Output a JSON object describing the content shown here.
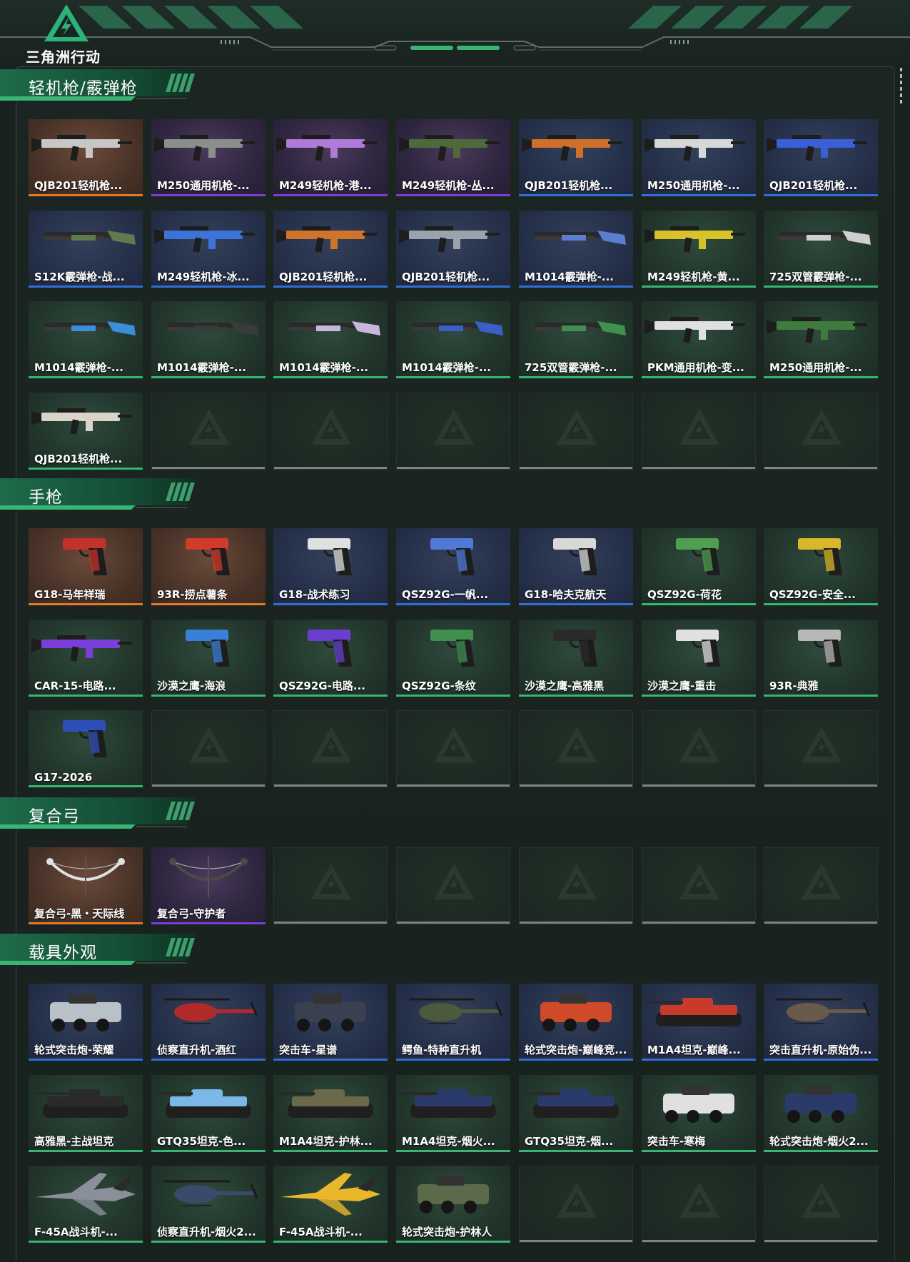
{
  "header": {
    "logo_text": "三角洲行动"
  },
  "colors": {
    "background": "#19221f",
    "accent_green": "#2fb27a",
    "rarity": {
      "orange": "#e07a2a",
      "purple": "#7b3fd0",
      "blue": "#2f6fd6",
      "green": "#36b574",
      "gray": "#7c8581"
    }
  },
  "sections": [
    {
      "title": "轻机枪/霰弹枪",
      "icon": "gun-icon",
      "items": [
        {
          "label": "QJB201轻机枪...",
          "rarity": "orange",
          "icon": "rifle-icon",
          "tone": "#c7c7c7"
        },
        {
          "label": "M250通用机枪-...",
          "rarity": "purple",
          "icon": "rifle-icon",
          "tone": "#8a8f8c"
        },
        {
          "label": "M249轻机枪-港...",
          "rarity": "purple",
          "icon": "rifle-icon",
          "tone": "#b07ad8"
        },
        {
          "label": "M249轻机枪-丛...",
          "rarity": "purple",
          "icon": "rifle-icon",
          "tone": "#4f6a3a"
        },
        {
          "label": "QJB201轻机枪...",
          "rarity": "blue",
          "icon": "rifle-icon",
          "tone": "#d06f2a"
        },
        {
          "label": "M250通用机枪-...",
          "rarity": "blue",
          "icon": "rifle-icon",
          "tone": "#d7d7d7"
        },
        {
          "label": "QJB201轻机枪...",
          "rarity": "blue",
          "icon": "rifle-icon",
          "tone": "#3b5fd6"
        },
        {
          "label": "S12K霰弹枪-战...",
          "rarity": "blue",
          "icon": "shotgun-icon",
          "tone": "#5f7a4e"
        },
        {
          "label": "M249轻机枪-冰...",
          "rarity": "blue",
          "icon": "rifle-icon",
          "tone": "#3b73d8"
        },
        {
          "label": "QJB201轻机枪...",
          "rarity": "blue",
          "icon": "rifle-icon",
          "tone": "#d0742a"
        },
        {
          "label": "QJB201轻机枪...",
          "rarity": "blue",
          "icon": "rifle-icon",
          "tone": "#9aa3ad"
        },
        {
          "label": "M1014霰弹枪-...",
          "rarity": "blue",
          "icon": "shotgun-icon",
          "tone": "#5a7fd0"
        },
        {
          "label": "M249轻机枪-黄...",
          "rarity": "green",
          "icon": "rifle-icon",
          "tone": "#d8c22a"
        },
        {
          "label": "725双管霰弹枪-...",
          "rarity": "green",
          "icon": "shotgun-icon",
          "tone": "#cfcfcf"
        },
        {
          "label": "M1014霰弹枪-...",
          "rarity": "green",
          "icon": "shotgun-icon",
          "tone": "#3a8fd8"
        },
        {
          "label": "M1014霰弹枪-...",
          "rarity": "green",
          "icon": "shotgun-icon",
          "tone": "#3a3a3a"
        },
        {
          "label": "M1014霰弹枪-...",
          "rarity": "green",
          "icon": "shotgun-icon",
          "tone": "#c9b6dd"
        },
        {
          "label": "M1014霰弹枪-...",
          "rarity": "green",
          "icon": "shotgun-icon",
          "tone": "#3a5fc8"
        },
        {
          "label": "725双管霰弹枪-...",
          "rarity": "green",
          "icon": "shotgun-icon",
          "tone": "#3f8f4f"
        },
        {
          "label": "PKM通用机枪-变...",
          "rarity": "green",
          "icon": "rifle-icon",
          "tone": "#e0e0e0"
        },
        {
          "label": "M250通用机枪-...",
          "rarity": "green",
          "icon": "rifle-icon",
          "tone": "#3f7a3f"
        },
        {
          "label": "QJB201轻机枪...",
          "rarity": "green",
          "icon": "rifle-icon",
          "tone": "#d8d4c8"
        }
      ],
      "empty_slots": 6
    },
    {
      "title": "手枪",
      "icon": "pistol-icon",
      "items": [
        {
          "label": "G18-马年祥瑞",
          "rarity": "orange",
          "icon": "pistol-icon",
          "tone": "#c0322a"
        },
        {
          "label": "93R-捞点薯条",
          "rarity": "orange",
          "icon": "pistol-icon",
          "tone": "#d23a2a"
        },
        {
          "label": "G18-战术练习",
          "rarity": "blue",
          "icon": "pistol-icon",
          "tone": "#e0e0e0"
        },
        {
          "label": "QSZ92G-一帆...",
          "rarity": "blue",
          "icon": "pistol-icon",
          "tone": "#4f7ad8"
        },
        {
          "label": "G18-哈夫克航天",
          "rarity": "blue",
          "icon": "pistol-icon",
          "tone": "#d8d8d8"
        },
        {
          "label": "QSZ92G-荷花",
          "rarity": "green",
          "icon": "pistol-icon",
          "tone": "#4f9f4f"
        },
        {
          "label": "QSZ92G-安全...",
          "rarity": "green",
          "icon": "pistol-icon",
          "tone": "#d8b82a"
        },
        {
          "label": "CAR-15-电路...",
          "rarity": "green",
          "icon": "rifle-icon",
          "tone": "#7a3fd8"
        },
        {
          "label": "沙漠之鹰-海浪",
          "rarity": "green",
          "icon": "pistol-icon",
          "tone": "#3a7fd8"
        },
        {
          "label": "QSZ92G-电路...",
          "rarity": "green",
          "icon": "pistol-icon",
          "tone": "#6a3fd0"
        },
        {
          "label": "QSZ92G-条纹",
          "rarity": "green",
          "icon": "pistol-icon",
          "tone": "#3f8f4f"
        },
        {
          "label": "沙漠之鹰-高雅黑",
          "rarity": "green",
          "icon": "pistol-icon",
          "tone": "#2a2a2a"
        },
        {
          "label": "沙漠之鹰-重击",
          "rarity": "green",
          "icon": "pistol-icon",
          "tone": "#e0e0e0"
        },
        {
          "label": "93R-典雅",
          "rarity": "green",
          "icon": "pistol-icon",
          "tone": "#b8b8b8"
        },
        {
          "label": "G17-2026",
          "rarity": "green",
          "icon": "pistol-icon",
          "tone": "#2f4fb8"
        }
      ],
      "empty_slots": 6
    },
    {
      "title": "复合弓",
      "icon": "bow-icon",
      "items": [
        {
          "label": "复合弓-黑・天际线",
          "rarity": "orange",
          "icon": "bow-icon",
          "tone": "#e0e0e0"
        },
        {
          "label": "复合弓-守护者",
          "rarity": "purple",
          "icon": "bow-icon",
          "tone": "#4a4a4a"
        }
      ],
      "empty_slots": 5
    },
    {
      "title": "载具外观",
      "icon": "vehicle-icon",
      "items": [
        {
          "label": "轮式突击炮-荣耀",
          "rarity": "blue",
          "icon": "armored-car-icon",
          "tone": "#b8c0c8"
        },
        {
          "label": "侦察直升机-酒红",
          "rarity": "blue",
          "icon": "helicopter-icon",
          "tone": "#b02a2a"
        },
        {
          "label": "突击车-星谱",
          "rarity": "blue",
          "icon": "armored-car-icon",
          "tone": "#3a4050"
        },
        {
          "label": "鳄鱼-特种直升机",
          "rarity": "blue",
          "icon": "helicopter-icon",
          "tone": "#4a5a3a"
        },
        {
          "label": "轮式突击炮-巅峰竞...",
          "rarity": "blue",
          "icon": "armored-car-icon",
          "tone": "#d04a2a"
        },
        {
          "label": "M1A4坦克-巅峰...",
          "rarity": "blue",
          "icon": "tank-icon",
          "tone": "#c83a2a"
        },
        {
          "label": "突击直升机-原始伪...",
          "rarity": "blue",
          "icon": "helicopter-icon",
          "tone": "#6a5a4a"
        },
        {
          "label": "高雅黑-主战坦克",
          "rarity": "green",
          "icon": "tank-icon",
          "tone": "#2a2a2a"
        },
        {
          "label": "GTQ35坦克-色...",
          "rarity": "green",
          "icon": "tank-icon",
          "tone": "#7ab8e8"
        },
        {
          "label": "M1A4坦克-护林...",
          "rarity": "green",
          "icon": "tank-icon",
          "tone": "#6a6a4a"
        },
        {
          "label": "M1A4坦克-烟火...",
          "rarity": "green",
          "icon": "tank-icon",
          "tone": "#2a3a6a"
        },
        {
          "label": "GTQ35坦克-烟...",
          "rarity": "green",
          "icon": "tank-icon",
          "tone": "#2a3a6a"
        },
        {
          "label": "突击车-寒梅",
          "rarity": "green",
          "icon": "armored-car-icon",
          "tone": "#e0e0e0"
        },
        {
          "label": "轮式突击炮-烟火2...",
          "rarity": "green",
          "icon": "armored-car-icon",
          "tone": "#2a3a6a"
        },
        {
          "label": "F-45A战斗机-...",
          "rarity": "green",
          "icon": "jet-icon",
          "tone": "#8a8f9a"
        },
        {
          "label": "侦察直升机-烟火2...",
          "rarity": "green",
          "icon": "helicopter-icon",
          "tone": "#3a4a6a"
        },
        {
          "label": "F-45A战斗机-...",
          "rarity": "green",
          "icon": "jet-icon",
          "tone": "#e8b82a"
        },
        {
          "label": "轮式突击炮-护林人",
          "rarity": "green",
          "icon": "armored-car-icon",
          "tone": "#5a6a4a"
        }
      ],
      "empty_slots": 3
    }
  ]
}
